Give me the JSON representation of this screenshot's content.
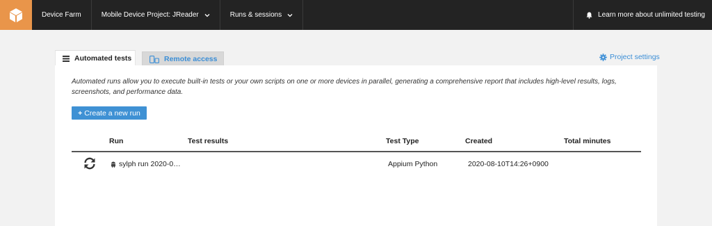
{
  "topbar": {
    "brand": "Device Farm",
    "project": "Mobile Device Project: JReader",
    "runs_sessions": "Runs & sessions",
    "learn_more": "Learn more about unlimited testing"
  },
  "tabs": [
    {
      "label": "Automated tests",
      "icon": "list-icon",
      "active": true
    },
    {
      "label": "Remote access",
      "icon": "devices-icon",
      "active": false
    }
  ],
  "project_settings": "Project settings",
  "description": "Automated runs allow you to execute built-in tests or your own scripts on one or more devices in parallel, generating a comprehensive report that includes high-level results, logs, screenshots, and performance data.",
  "create_button": {
    "plus": "+",
    "label": "Create a new run"
  },
  "table": {
    "columns": [
      "Run",
      "Test results",
      "Test Type",
      "Created",
      "Total minutes"
    ],
    "rows": [
      {
        "status_icon": "refresh-icon",
        "run": "sylph run 2020-0…",
        "test_results": "",
        "test_type": "Appium Python",
        "created": "2020-08-10T14:26+0900",
        "total_minutes": ""
      }
    ]
  },
  "colors": {
    "topbar": "#232323",
    "logo": "#e9954a",
    "accent": "#3b8ed6",
    "button": "#3f91d4"
  }
}
